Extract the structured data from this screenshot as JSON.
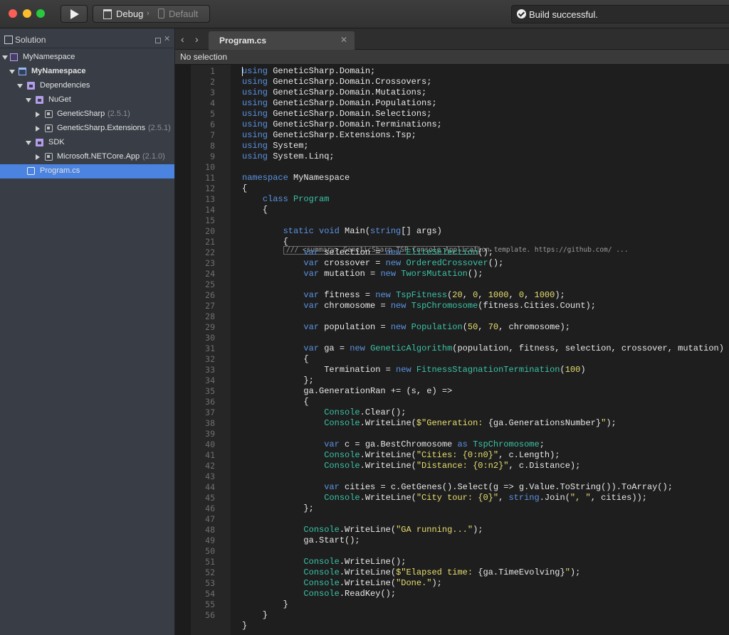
{
  "toolbar": {
    "config": "Debug",
    "target": "Default",
    "status": "Build successful."
  },
  "solution": {
    "title": "Solution",
    "tree": [
      {
        "label": "MyNamespace",
        "version": "",
        "icon": "solution-icon"
      },
      {
        "label": "MyNamespace",
        "version": "",
        "icon": "project-icon"
      },
      {
        "label": "Dependencies",
        "version": "",
        "icon": "folder-icon"
      },
      {
        "label": "NuGet",
        "version": "",
        "icon": "folder-icon"
      },
      {
        "label": "GeneticSharp",
        "version": "(2.5.1)",
        "icon": "package-icon"
      },
      {
        "label": "GeneticSharp.Extensions",
        "version": "(2.5.1)",
        "icon": "package-icon"
      },
      {
        "label": "SDK",
        "version": "",
        "icon": "folder-icon"
      },
      {
        "label": "Microsoft.NETCore.App",
        "version": "(2.1.0)",
        "icon": "package-icon"
      },
      {
        "label": "Program.cs",
        "version": "",
        "icon": "csharp-file-icon"
      }
    ]
  },
  "editor": {
    "tab": "Program.cs",
    "path": "No selection",
    "fold_summary": "/// <summary> GeneticSharp TSP Console Application template. https://github.com/ ...",
    "line_numbers": [
      "1",
      "2",
      "3",
      "4",
      "5",
      "6",
      "7",
      "8",
      "9",
      "10",
      "11",
      "12",
      "13",
      "14",
      "15",
      "20",
      "21",
      "22",
      "23",
      "24",
      "25",
      "26",
      "27",
      "28",
      "29",
      "30",
      "31",
      "32",
      "33",
      "34",
      "35",
      "36",
      "37",
      "38",
      "39",
      "40",
      "41",
      "42",
      "43",
      "44",
      "45",
      "46",
      "47",
      "48",
      "49",
      "50",
      "51",
      "52",
      "53",
      "54",
      "55",
      "56"
    ],
    "lines": [
      [
        [
          "kw",
          "using"
        ],
        [
          "",
          "GeneticSharp.Domain;"
        ]
      ],
      [
        [
          "kw",
          "using"
        ],
        [
          "",
          "GeneticSharp.Domain.Crossovers;"
        ]
      ],
      [
        [
          "kw",
          "using"
        ],
        [
          "",
          "GeneticSharp.Domain.Mutations;"
        ]
      ],
      [
        [
          "kw",
          "using"
        ],
        [
          "",
          "GeneticSharp.Domain.Populations;"
        ]
      ],
      [
        [
          "kw",
          "using"
        ],
        [
          "",
          "GeneticSharp.Domain.Selections;"
        ]
      ],
      [
        [
          "kw",
          "using"
        ],
        [
          "",
          "GeneticSharp.Domain.Terminations;"
        ]
      ],
      [
        [
          "kw",
          "using"
        ],
        [
          "",
          "GeneticSharp.Extensions.Tsp;"
        ]
      ],
      [
        [
          "kw",
          "using"
        ],
        [
          "",
          "System;"
        ]
      ],
      [
        [
          "kw",
          "using"
        ],
        [
          "",
          "System.Linq;"
        ]
      ],
      [],
      [
        [
          "kw",
          "namespace"
        ],
        [
          "",
          "MyNamespace"
        ]
      ],
      [
        [
          "",
          "{"
        ]
      ],
      [
        [
          "",
          "    "
        ],
        [
          "kw",
          "class"
        ],
        [
          "ty",
          "Program"
        ]
      ],
      [
        [
          "",
          "    {"
        ]
      ],
      [],
      [
        [
          "",
          "        "
        ],
        [
          "kw",
          "static void"
        ],
        [
          "",
          "Main("
        ],
        [
          "kw",
          "string"
        ],
        [
          "",
          "[] args)"
        ]
      ],
      [
        [
          "",
          "        {"
        ]
      ],
      [
        [
          "",
          "            "
        ],
        [
          "kw",
          "var"
        ],
        [
          "",
          "selection = "
        ],
        [
          "kw",
          "new"
        ],
        [
          "ty",
          "EliteSelection"
        ],
        [
          "",
          "();"
        ]
      ],
      [
        [
          "",
          "            "
        ],
        [
          "kw",
          "var"
        ],
        [
          "",
          "crossover = "
        ],
        [
          "kw",
          "new"
        ],
        [
          "ty",
          "OrderedCrossover"
        ],
        [
          "",
          "();"
        ]
      ],
      [
        [
          "",
          "            "
        ],
        [
          "kw",
          "var"
        ],
        [
          "",
          "mutation = "
        ],
        [
          "kw",
          "new"
        ],
        [
          "ty",
          "TworsMutation"
        ],
        [
          "",
          "();"
        ]
      ],
      [],
      [
        [
          "",
          "            "
        ],
        [
          "kw",
          "var"
        ],
        [
          "",
          "fitness = "
        ],
        [
          "kw",
          "new"
        ],
        [
          "ty",
          "TspFitness"
        ],
        [
          "",
          "("
        ],
        [
          "nm",
          "20"
        ],
        [
          "",
          ", "
        ],
        [
          "nm",
          "0"
        ],
        [
          "",
          ", "
        ],
        [
          "nm",
          "1000"
        ],
        [
          "",
          ", "
        ],
        [
          "nm",
          "0"
        ],
        [
          "",
          ", "
        ],
        [
          "nm",
          "1000"
        ],
        [
          "",
          ");"
        ]
      ],
      [
        [
          "",
          "            "
        ],
        [
          "kw",
          "var"
        ],
        [
          "",
          "chromosome = "
        ],
        [
          "kw",
          "new"
        ],
        [
          "ty",
          "TspChromosome"
        ],
        [
          "",
          "(fitness.Cities.Count);"
        ]
      ],
      [],
      [
        [
          "",
          "            "
        ],
        [
          "kw",
          "var"
        ],
        [
          "",
          "population = "
        ],
        [
          "kw",
          "new"
        ],
        [
          "ty",
          "Population"
        ],
        [
          "",
          "("
        ],
        [
          "nm",
          "50"
        ],
        [
          "",
          ", "
        ],
        [
          "nm",
          "70"
        ],
        [
          "",
          ", chromosome);"
        ]
      ],
      [],
      [
        [
          "",
          "            "
        ],
        [
          "kw",
          "var"
        ],
        [
          "",
          "ga = "
        ],
        [
          "kw",
          "new"
        ],
        [
          "ty",
          "GeneticAlgorithm"
        ],
        [
          "",
          "(population, fitness, selection, crossover, mutation)"
        ]
      ],
      [
        [
          "",
          "            {"
        ]
      ],
      [
        [
          "",
          "                Termination = "
        ],
        [
          "kw",
          "new"
        ],
        [
          "ty",
          "FitnessStagnationTermination"
        ],
        [
          "",
          "("
        ],
        [
          "nm",
          "100"
        ],
        [
          "",
          ")"
        ]
      ],
      [
        [
          "",
          "            };"
        ]
      ],
      [
        [
          "",
          "            ga.GenerationRan += (s, e) =>"
        ]
      ],
      [
        [
          "",
          "            {"
        ]
      ],
      [
        [
          "",
          "                "
        ],
        [
          "ty",
          "Console"
        ],
        [
          "",
          ".Clear();"
        ]
      ],
      [
        [
          "",
          "                "
        ],
        [
          "ty",
          "Console"
        ],
        [
          "",
          ".WriteLine("
        ],
        [
          "st",
          "$\"Generation: "
        ],
        [
          "",
          "{ga.GenerationsNumber}"
        ],
        [
          "st",
          "\""
        ],
        [
          "",
          ");"
        ]
      ],
      [],
      [
        [
          "",
          "                "
        ],
        [
          "kw",
          "var"
        ],
        [
          "",
          "c = ga.BestChromosome "
        ],
        [
          "kw",
          "as"
        ],
        [
          "ty",
          "TspChromosome"
        ],
        [
          "",
          ";"
        ]
      ],
      [
        [
          "",
          "                "
        ],
        [
          "ty",
          "Console"
        ],
        [
          "",
          ".WriteLine("
        ],
        [
          "st",
          "\"Cities: {0:n0}\""
        ],
        [
          "",
          ", c.Length);"
        ]
      ],
      [
        [
          "",
          "                "
        ],
        [
          "ty",
          "Console"
        ],
        [
          "",
          ".WriteLine("
        ],
        [
          "st",
          "\"Distance: {0:n2}\""
        ],
        [
          "",
          ", c.Distance);"
        ]
      ],
      [],
      [
        [
          "",
          "                "
        ],
        [
          "kw",
          "var"
        ],
        [
          "",
          "cities = c.GetGenes().Select(g => g.Value.ToString()).ToArray();"
        ]
      ],
      [
        [
          "",
          "                "
        ],
        [
          "ty",
          "Console"
        ],
        [
          "",
          ".WriteLine("
        ],
        [
          "st",
          "\"City tour: {0}\""
        ],
        [
          "",
          ", "
        ],
        [
          "kw",
          "string"
        ],
        [
          "",
          ".Join("
        ],
        [
          "st",
          "\", \""
        ],
        [
          "",
          ", cities));"
        ]
      ],
      [
        [
          "",
          "            };"
        ]
      ],
      [],
      [
        [
          "",
          "            "
        ],
        [
          "ty",
          "Console"
        ],
        [
          "",
          ".WriteLine("
        ],
        [
          "st",
          "\"GA running...\""
        ],
        [
          "",
          ");"
        ]
      ],
      [
        [
          "",
          "            ga.Start();"
        ]
      ],
      [],
      [
        [
          "",
          "            "
        ],
        [
          "ty",
          "Console"
        ],
        [
          "",
          ".WriteLine();"
        ]
      ],
      [
        [
          "",
          "            "
        ],
        [
          "ty",
          "Console"
        ],
        [
          "",
          ".WriteLine("
        ],
        [
          "st",
          "$\"Elapsed time: "
        ],
        [
          "",
          "{ga.TimeEvolving}"
        ],
        [
          "st",
          "\""
        ],
        [
          "",
          ");"
        ]
      ],
      [
        [
          "",
          "            "
        ],
        [
          "ty",
          "Console"
        ],
        [
          "",
          ".WriteLine("
        ],
        [
          "st",
          "\"Done.\""
        ],
        [
          "",
          ");"
        ]
      ],
      [
        [
          "",
          "            "
        ],
        [
          "ty",
          "Console"
        ],
        [
          "",
          ".ReadKey();"
        ]
      ],
      [
        [
          "",
          "        }"
        ]
      ],
      [
        [
          "",
          "    }"
        ]
      ],
      [
        [
          "",
          "}"
        ]
      ]
    ]
  }
}
